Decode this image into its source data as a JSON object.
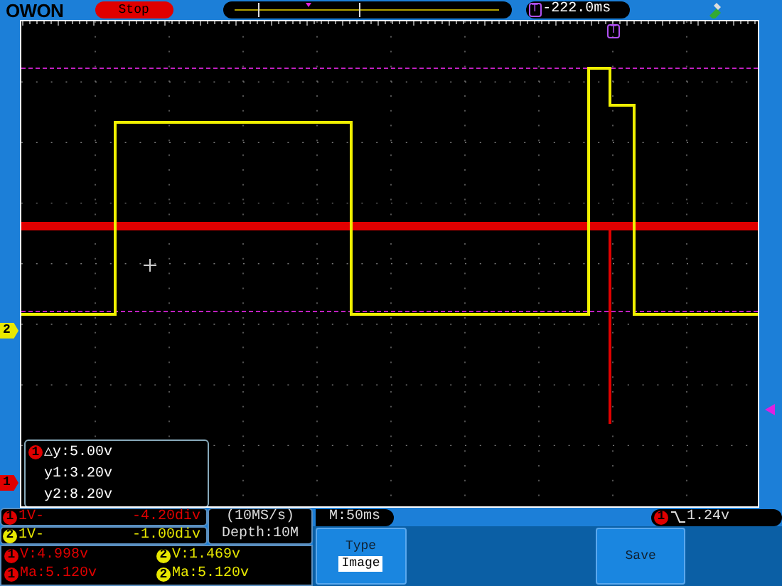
{
  "top_bar": {
    "logo": "OWON",
    "run_state": "Stop",
    "trigger_badge": "T",
    "trigger_time": "-222.0ms"
  },
  "scope": {
    "trigger_marker": "T"
  },
  "channel_markers": [
    {
      "label": "2",
      "color": "#e8e800"
    },
    {
      "label": "1",
      "color": "#e00000"
    }
  ],
  "cursor_readout": {
    "channel": "1",
    "lines": [
      "△y:5.00v",
      "y1:3.20v",
      "y2:8.20v"
    ]
  },
  "channels": [
    {
      "badge": "1",
      "color": "#e00000",
      "scale": "1V-",
      "offset": "-4.20div"
    },
    {
      "badge": "2",
      "color": "#e8e800",
      "scale": "1V-",
      "offset": "-1.00div"
    }
  ],
  "acquisition": {
    "sample_rate": "(10MS/s)",
    "depth": "Depth:10M"
  },
  "timebase": "M:50ms",
  "trigger_level": {
    "channel": "1",
    "level": "1.24v"
  },
  "measurements": [
    {
      "channel": "1",
      "color": "#e00000",
      "value": "V:4.998v"
    },
    {
      "channel": "1",
      "color": "#e00000",
      "value": "Ma:5.120v"
    },
    {
      "channel": "2",
      "color": "#e8e800",
      "value": "V:1.469v"
    },
    {
      "channel": "2",
      "color": "#e8e800",
      "value": "Ma:5.120v"
    }
  ],
  "menu": [
    {
      "kind": "option",
      "label": "Type",
      "value": "Image"
    },
    {
      "kind": "action",
      "label": "Save"
    }
  ]
}
